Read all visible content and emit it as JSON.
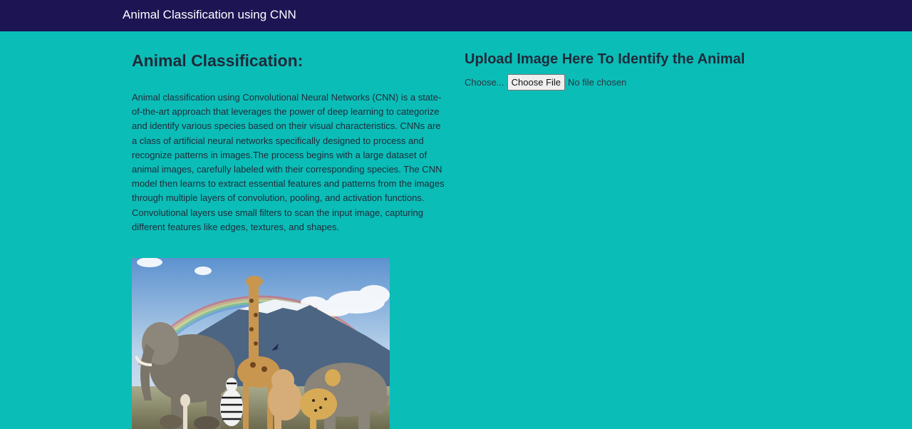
{
  "navbar": {
    "brand": "Animal Classification using CNN"
  },
  "left": {
    "heading": "Animal Classification:",
    "description": "Animal classification using Convolutional Neural Networks (CNN) is a state-of-the-art approach that leverages the power of deep learning to categorize and identify various species based on their visual characteristics. CNNs are a class of artificial neural networks specifically designed to process and recognize patterns in images.The process begins with a large dataset of animal images, carefully labeled with their corresponding species. The CNN model then learns to extract essential features and patterns from the images through multiple layers of convolution, pooling, and activation functions. Convolutional layers use small filters to scan the input image, capturing different features like edges, textures, and shapes."
  },
  "upload": {
    "heading": "Upload Image Here To Identify the Animal",
    "choose_label": "Choose...",
    "button_label": "Choose File",
    "file_status": "No file chosen"
  },
  "colors": {
    "page_background": "#0bbdb7",
    "navbar_background": "#1d1454",
    "heading_text": "#1f2a3a"
  }
}
